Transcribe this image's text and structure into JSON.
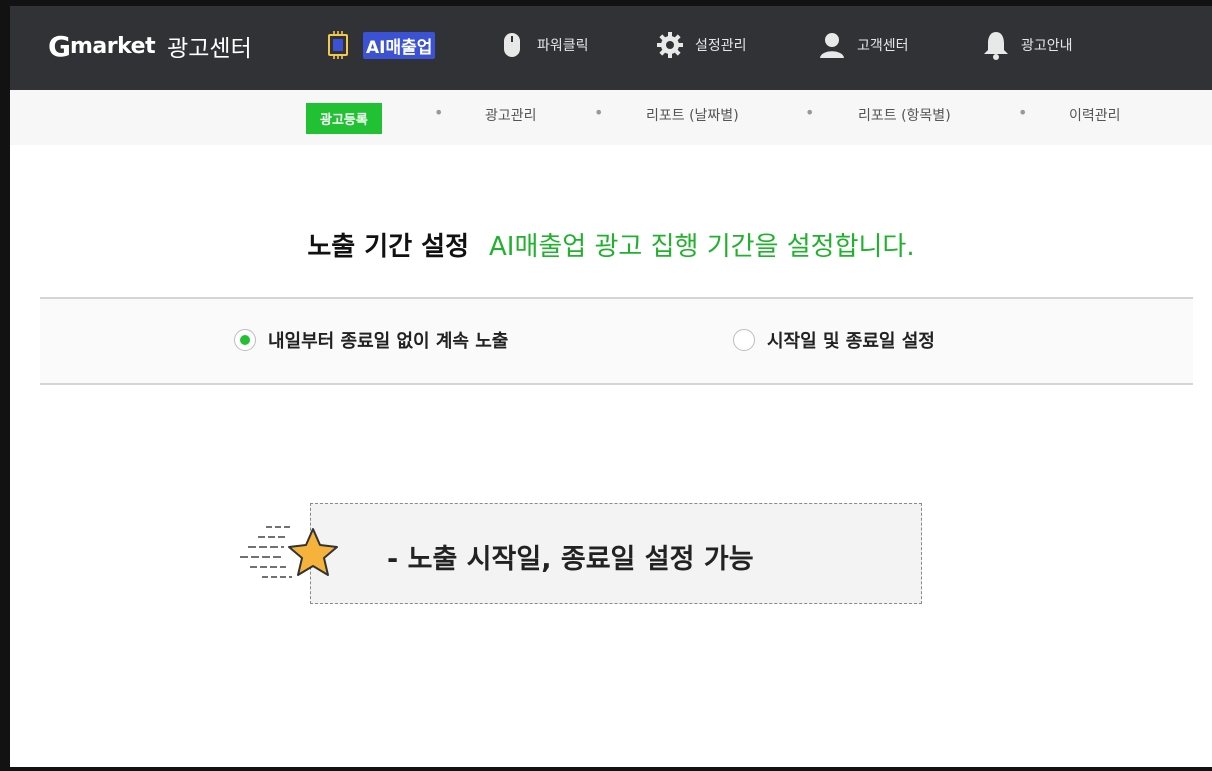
{
  "header": {
    "logo_g": "G",
    "logo_market": "market",
    "logo_center": "광고센터",
    "menu": [
      {
        "label": "AI매출업",
        "icon": "chip-icon"
      },
      {
        "label": "파워클릭",
        "icon": "mouse-icon"
      },
      {
        "label": "설정관리",
        "icon": "gear-icon"
      },
      {
        "label": "고객센터",
        "icon": "person-icon"
      },
      {
        "label": "광고안내",
        "icon": "bell-icon"
      }
    ]
  },
  "subnav": {
    "items": [
      "광고등록",
      "광고관리",
      "리포트 (날짜별)",
      "리포트 (항목별)",
      "이력관리"
    ],
    "separator": "•"
  },
  "section": {
    "title": "노출 기간 설정",
    "description": "AI매출업 광고 집행 기간을 설정합니다."
  },
  "options": [
    {
      "label": "내일부터 종료일 없이 계속 노출",
      "selected": true
    },
    {
      "label": "시작일 및 종료일 설정",
      "selected": false
    }
  ],
  "info": {
    "text": "- 노출 시작일, 종료일 설정 가능",
    "icon": "star-icon"
  },
  "colors": {
    "accent_green": "#22c133",
    "nav_bg": "#303236",
    "active_menu_bg": "#3b52d4",
    "star_fill": "#f6b33b"
  }
}
